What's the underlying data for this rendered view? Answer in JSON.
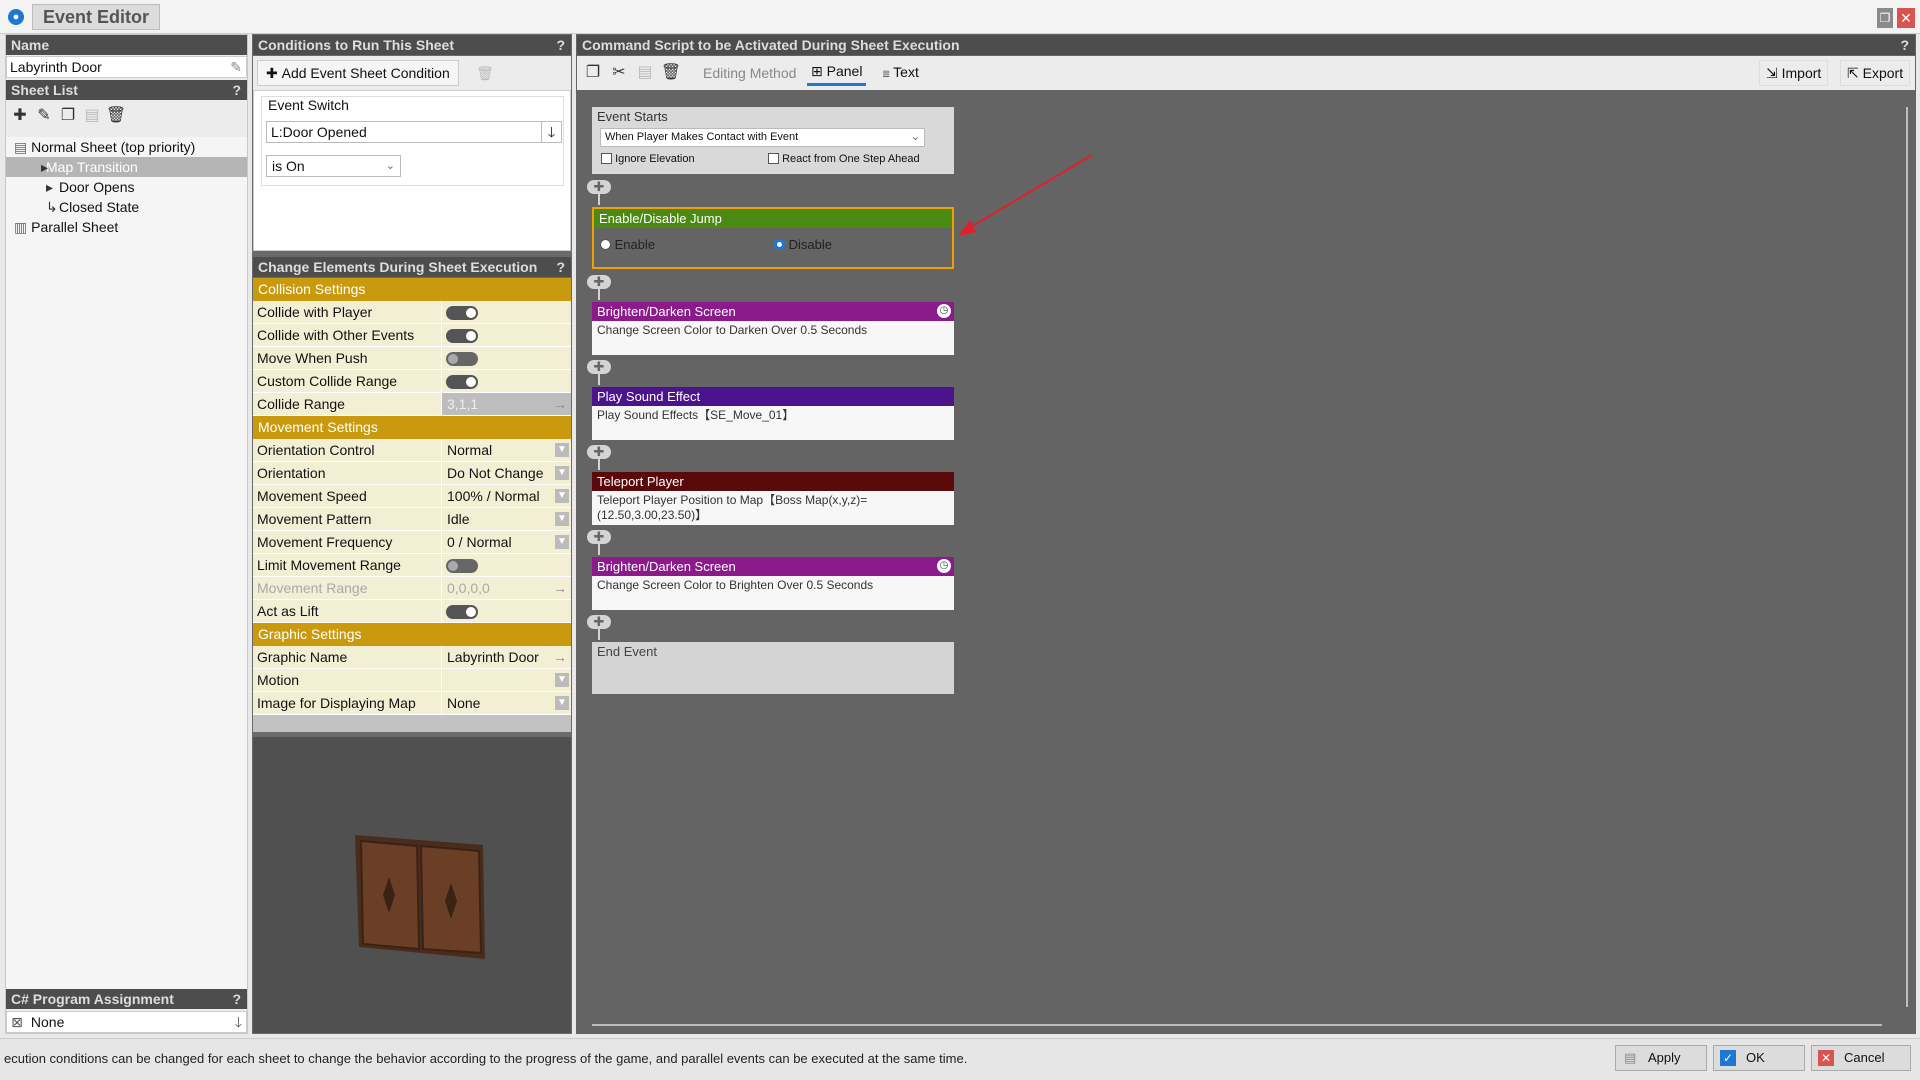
{
  "window": {
    "title": "Event Editor",
    "app_icon": "globe-icon"
  },
  "name_section": {
    "header": "Name",
    "value": "Labyrinth Door"
  },
  "sheet_list": {
    "header": "Sheet List",
    "help": "?",
    "items": [
      {
        "label": "Normal Sheet (top priority)"
      },
      {
        "label": "Map Transition"
      },
      {
        "label": "Door Opens"
      },
      {
        "label": "Closed State"
      },
      {
        "label": "Parallel Sheet"
      }
    ]
  },
  "csharp": {
    "header": "C# Program Assignment",
    "help": "?",
    "value": "None"
  },
  "conditions": {
    "header": "Conditions to Run This Sheet",
    "help": "?",
    "add_label": "Add Event Sheet Condition",
    "switch_label": "Event Switch",
    "switch_value": "L:Door Opened",
    "state_value": "is On"
  },
  "change_elements": {
    "header": "Change Elements During Sheet Execution",
    "help": "?",
    "collision_header": "Collision Settings",
    "collision": [
      {
        "key": "Collide with Player",
        "toggle": true
      },
      {
        "key": "Collide with Other Events",
        "toggle": true
      },
      {
        "key": "Move When Push",
        "toggle": false
      },
      {
        "key": "Custom Collide Range",
        "toggle": true
      },
      {
        "key": "Collide Range",
        "value": "3,1,1"
      }
    ],
    "movement_header": "Movement Settings",
    "movement": [
      {
        "key": "Orientation Control",
        "value": "Normal"
      },
      {
        "key": "Orientation",
        "value": "Do Not Change"
      },
      {
        "key": "Movement Speed",
        "value": "100% / Normal"
      },
      {
        "key": "Movement Pattern",
        "value": "Idle"
      },
      {
        "key": "Movement Frequency",
        "value": "0 / Normal"
      },
      {
        "key": "Limit Movement Range",
        "toggle": false
      },
      {
        "key": "Movement Range",
        "value": "0,0,0,0"
      },
      {
        "key": "Act as Lift",
        "toggle": true
      }
    ],
    "graphic_header": "Graphic Settings",
    "graphic": [
      {
        "key": "Graphic Name",
        "value": "Labyrinth Door"
      },
      {
        "key": "Motion",
        "value": ""
      },
      {
        "key": "Image for Displaying Map",
        "value": "None"
      }
    ]
  },
  "script": {
    "header": "Command Script to be Activated During Sheet Execution",
    "help": "?",
    "editing_method": "Editing Method",
    "panel_label": "Panel",
    "text_label": "Text",
    "import_label": "Import",
    "export_label": "Export",
    "event_starts": {
      "title": "Event Starts",
      "trigger": "When Player Makes Contact with Event",
      "ignore_elevation": "Ignore Elevation",
      "react_ahead": "React from One Step Ahead"
    },
    "commands": [
      {
        "title": "Enable/Disable Jump",
        "color": "#4a8a12",
        "enable": "Enable",
        "disable": "Disable",
        "selected": "Disable"
      },
      {
        "title": "Brighten/Darken Screen",
        "color": "#8b1a8b",
        "body": "Change Screen Color to Darken Over 0.5 Seconds"
      },
      {
        "title": "Play Sound Effect",
        "color": "#4b148c",
        "body": "Play Sound Effects【SE_Move_01】"
      },
      {
        "title": "Teleport Player",
        "color": "#5a0a0a",
        "body": "Teleport Player Position to Map【Boss Map(x,y,z)=(12.50,3.00,23.50)】"
      },
      {
        "title": "Brighten/Darken Screen",
        "color": "#8b1a8b",
        "body": "Change Screen Color to Brighten Over 0.5 Seconds"
      }
    ],
    "end_event": "End Event"
  },
  "status": {
    "message": "ecution conditions can be changed for each sheet to change the behavior according to the progress of the game, and parallel events can be executed at the same time.",
    "apply": "Apply",
    "ok": "OK",
    "cancel": "Cancel"
  }
}
